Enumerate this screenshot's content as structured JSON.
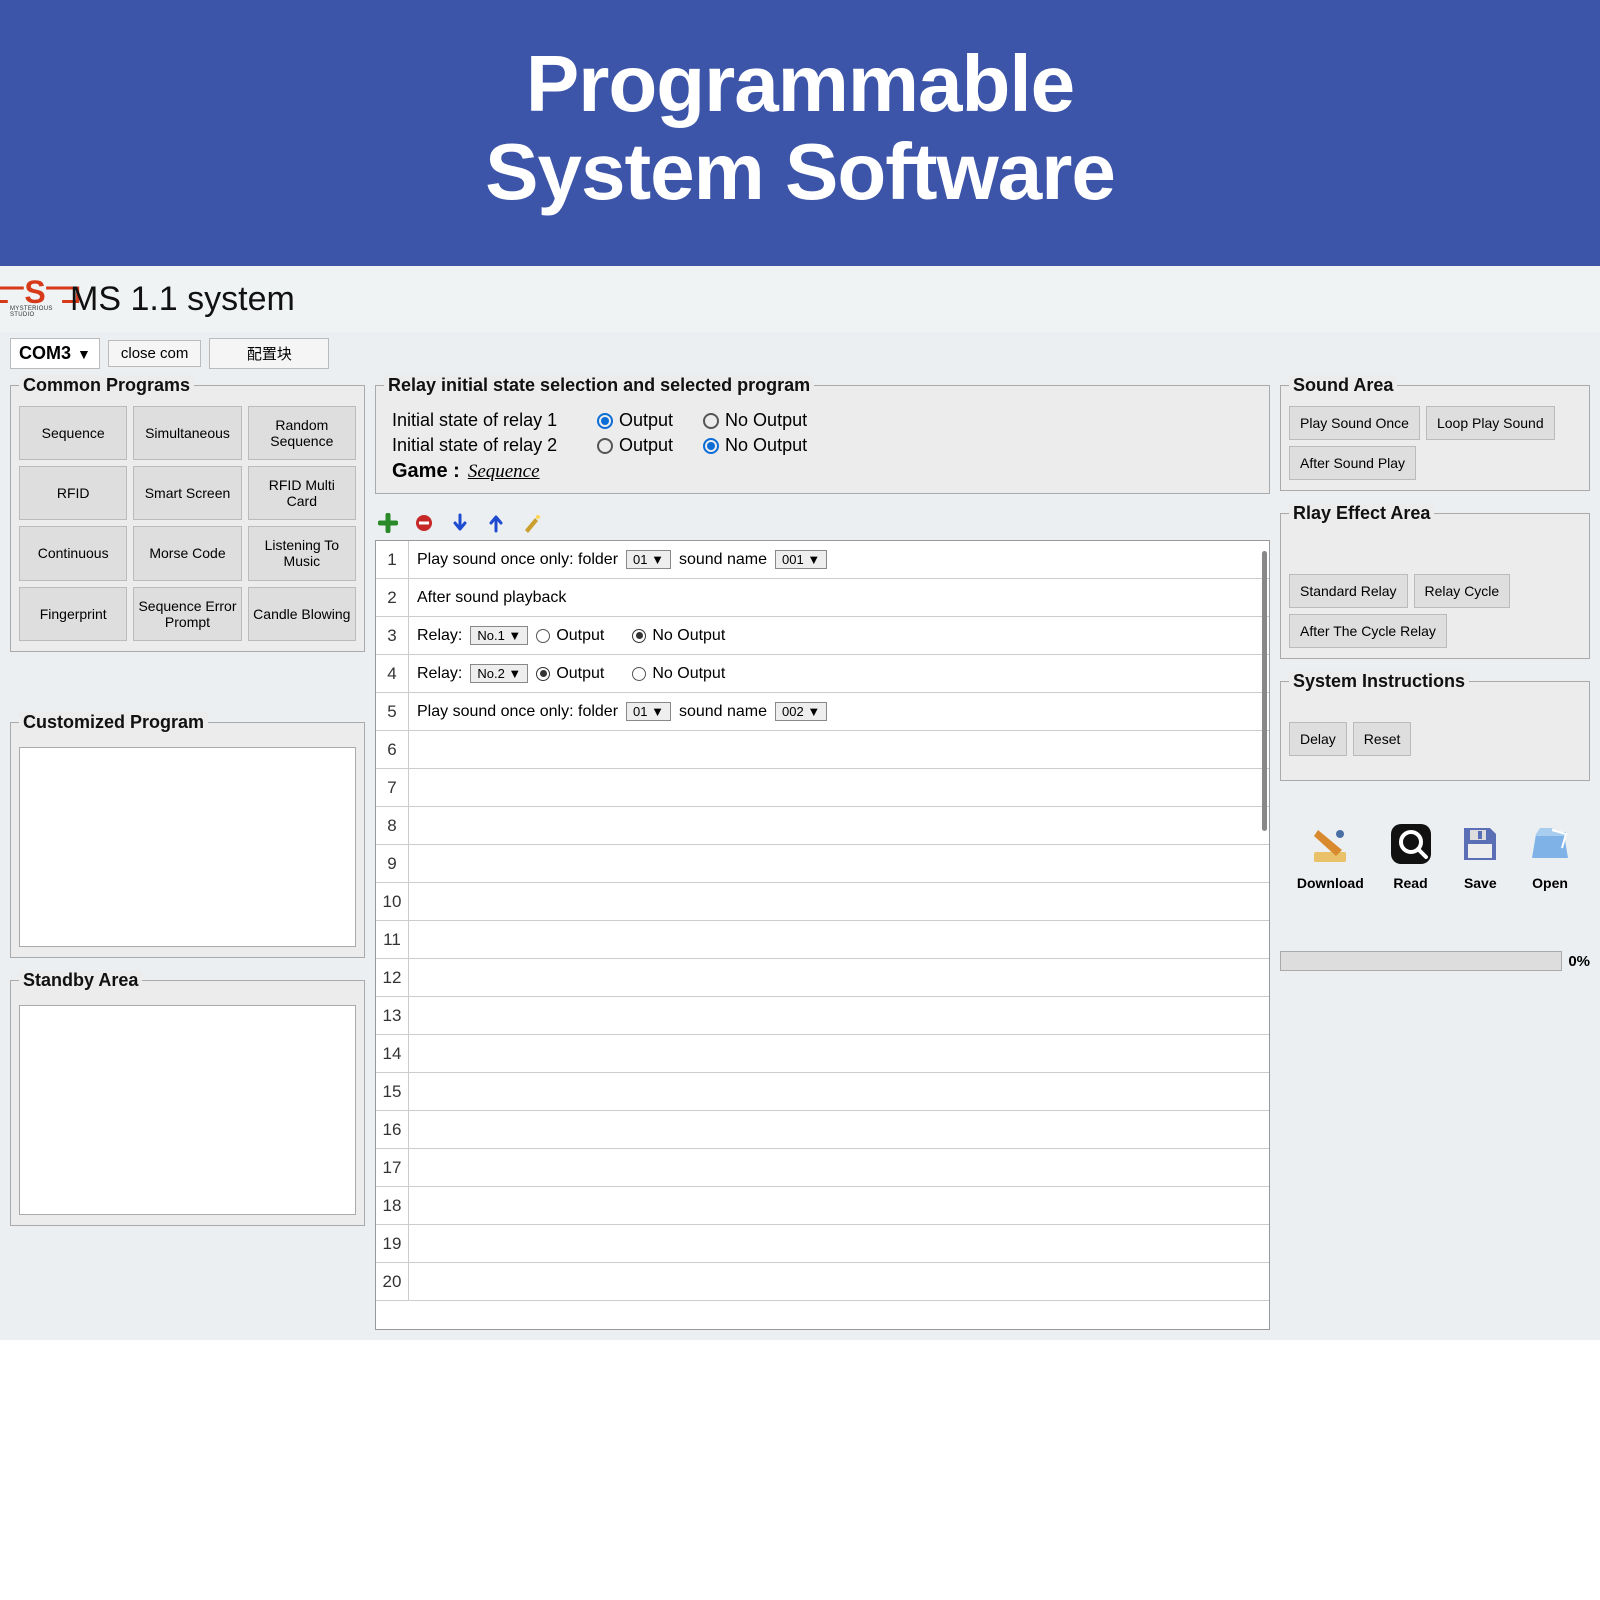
{
  "banner": {
    "line1": "Programmable",
    "line2": "System Software"
  },
  "titlebar": {
    "logo_sub": "MYSTERIOUS STUDIO",
    "system_title": "MS 1.1 system"
  },
  "toolbar": {
    "com_port": "COM3",
    "close_com": "close  com",
    "config": "配置块"
  },
  "common_programs": {
    "legend": "Common Programs",
    "items": [
      "Sequence",
      "Simultaneous",
      "Random Sequence",
      "RFID",
      "Smart Screen",
      "RFID Multi Card",
      "Continuous",
      "Morse Code",
      "Listening To Music",
      "Fingerprint",
      "Sequence Error Prompt",
      "Candle Blowing"
    ]
  },
  "customized": {
    "legend": "Customized Program"
  },
  "standby": {
    "legend": "Standby Area"
  },
  "relay": {
    "legend": "Relay initial state selection and selected program",
    "row1": {
      "label": "Initial state of relay 1",
      "opt1": "Output",
      "opt2": "No Output",
      "selected": "opt1"
    },
    "row2": {
      "label": "Initial state of relay 2",
      "opt1": "Output",
      "opt2": "No Output",
      "selected": "opt2"
    },
    "game_label": "Game :",
    "game_value": "Sequence"
  },
  "grid": {
    "rows": 20,
    "r1": {
      "text_a": "Play sound once only: folder",
      "folder": "01",
      "text_b": "sound name",
      "name": "001"
    },
    "r2": {
      "text": "After sound playback"
    },
    "r3": {
      "label": "Relay:",
      "select": "No.1",
      "opt1": "Output",
      "opt2": "No Output",
      "selected": "opt2"
    },
    "r4": {
      "label": "Relay:",
      "select": "No.2",
      "opt1": "Output",
      "opt2": "No Output",
      "selected": "opt1"
    },
    "r5": {
      "text_a": "Play sound once only: folder",
      "folder": "01",
      "text_b": "sound name",
      "name": "002"
    }
  },
  "sound_area": {
    "legend": "Sound Area",
    "b1": "Play Sound Once",
    "b2": "Loop Play Sound",
    "b3": "After Sound Play"
  },
  "relay_effect": {
    "legend": "Rlay Effect Area",
    "b1": "Standard Relay",
    "b2": "Relay Cycle",
    "b3": "After The Cycle Relay"
  },
  "sys_instr": {
    "legend": "System Instructions",
    "b1": "Delay",
    "b2": "Reset"
  },
  "actions": {
    "download": "Download",
    "read": "Read",
    "save": "Save",
    "open": "Open"
  },
  "progress": {
    "percent": "0%"
  }
}
